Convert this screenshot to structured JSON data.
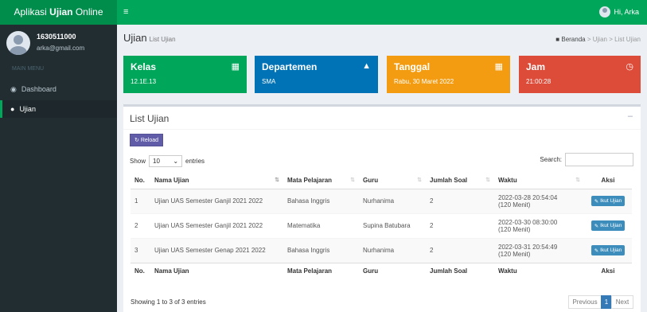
{
  "app": {
    "brand_prefix": "Aplikasi ",
    "brand_bold": "Ujian",
    "brand_suffix": " Online",
    "greeting": "Hi, Arka"
  },
  "sidebar": {
    "user_id": "1630511000",
    "email": "arka@gmail.com",
    "menu_header": "MAIN MENU",
    "items": [
      {
        "label": "Dashboard",
        "icon": "dashboard-icon"
      },
      {
        "label": "Ujian",
        "icon": "ujian-icon"
      }
    ]
  },
  "page": {
    "title": "Ujian",
    "subtitle": "List Ujian"
  },
  "breadcrumb": {
    "home": "Beranda",
    "sep": " > ",
    "section": "Ujian",
    "current": "List Ujian"
  },
  "cards": [
    {
      "title": "Kelas",
      "value": "12.1E.13",
      "color": "#00a65a",
      "icon": "building-icon"
    },
    {
      "title": "Departemen",
      "value": "SMA",
      "color": "#0073b7",
      "icon": "graduation-cap-icon"
    },
    {
      "title": "Tanggal",
      "value": "Rabu, 30 Maret 2022",
      "color": "#f39c12",
      "icon": "calendar-icon"
    },
    {
      "title": "Jam",
      "value": "21:00:28",
      "color": "#dd4b39",
      "icon": "clock-icon"
    }
  ],
  "box": {
    "title": "List Ujian",
    "reload_label": "Reload",
    "show_label": "Show",
    "entries_value": "10",
    "entries_label": "entries",
    "search_label": "Search:",
    "search_value": "",
    "columns": [
      "No.",
      "Nama Ujian",
      "Mata Pelajaran",
      "Guru",
      "Jumlah Soal",
      "Waktu",
      "Aksi"
    ],
    "rows": [
      {
        "no": "1",
        "nama": "Ujian UAS Semester Ganjil 2021 2022",
        "mapel": "Bahasa Inggris",
        "guru": "Nurhanima",
        "jumlah": "2",
        "waktu": "2022-03-28 20:54:04",
        "durasi": "(120 Menit)",
        "aksi": "Ikut Ujian"
      },
      {
        "no": "2",
        "nama": "Ujian UAS Semester Ganjil 2021 2022",
        "mapel": "Matematika",
        "guru": "Supina Batubara",
        "jumlah": "2",
        "waktu": "2022-03-30 08:30:00",
        "durasi": "(120 Menit)",
        "aksi": "Ikut Ujian"
      },
      {
        "no": "3",
        "nama": "Ujian UAS Semester Genap 2021 2022",
        "mapel": "Bahasa Inggris",
        "guru": "Nurhanima",
        "jumlah": "2",
        "waktu": "2022-03-31 20:54:49",
        "durasi": "(120 Menit)",
        "aksi": "Ikut Ujian"
      }
    ],
    "showing": "Showing 1 to 3 of 3 entries",
    "pager": {
      "prev": "Previous",
      "page": "1",
      "next": "Next"
    }
  }
}
